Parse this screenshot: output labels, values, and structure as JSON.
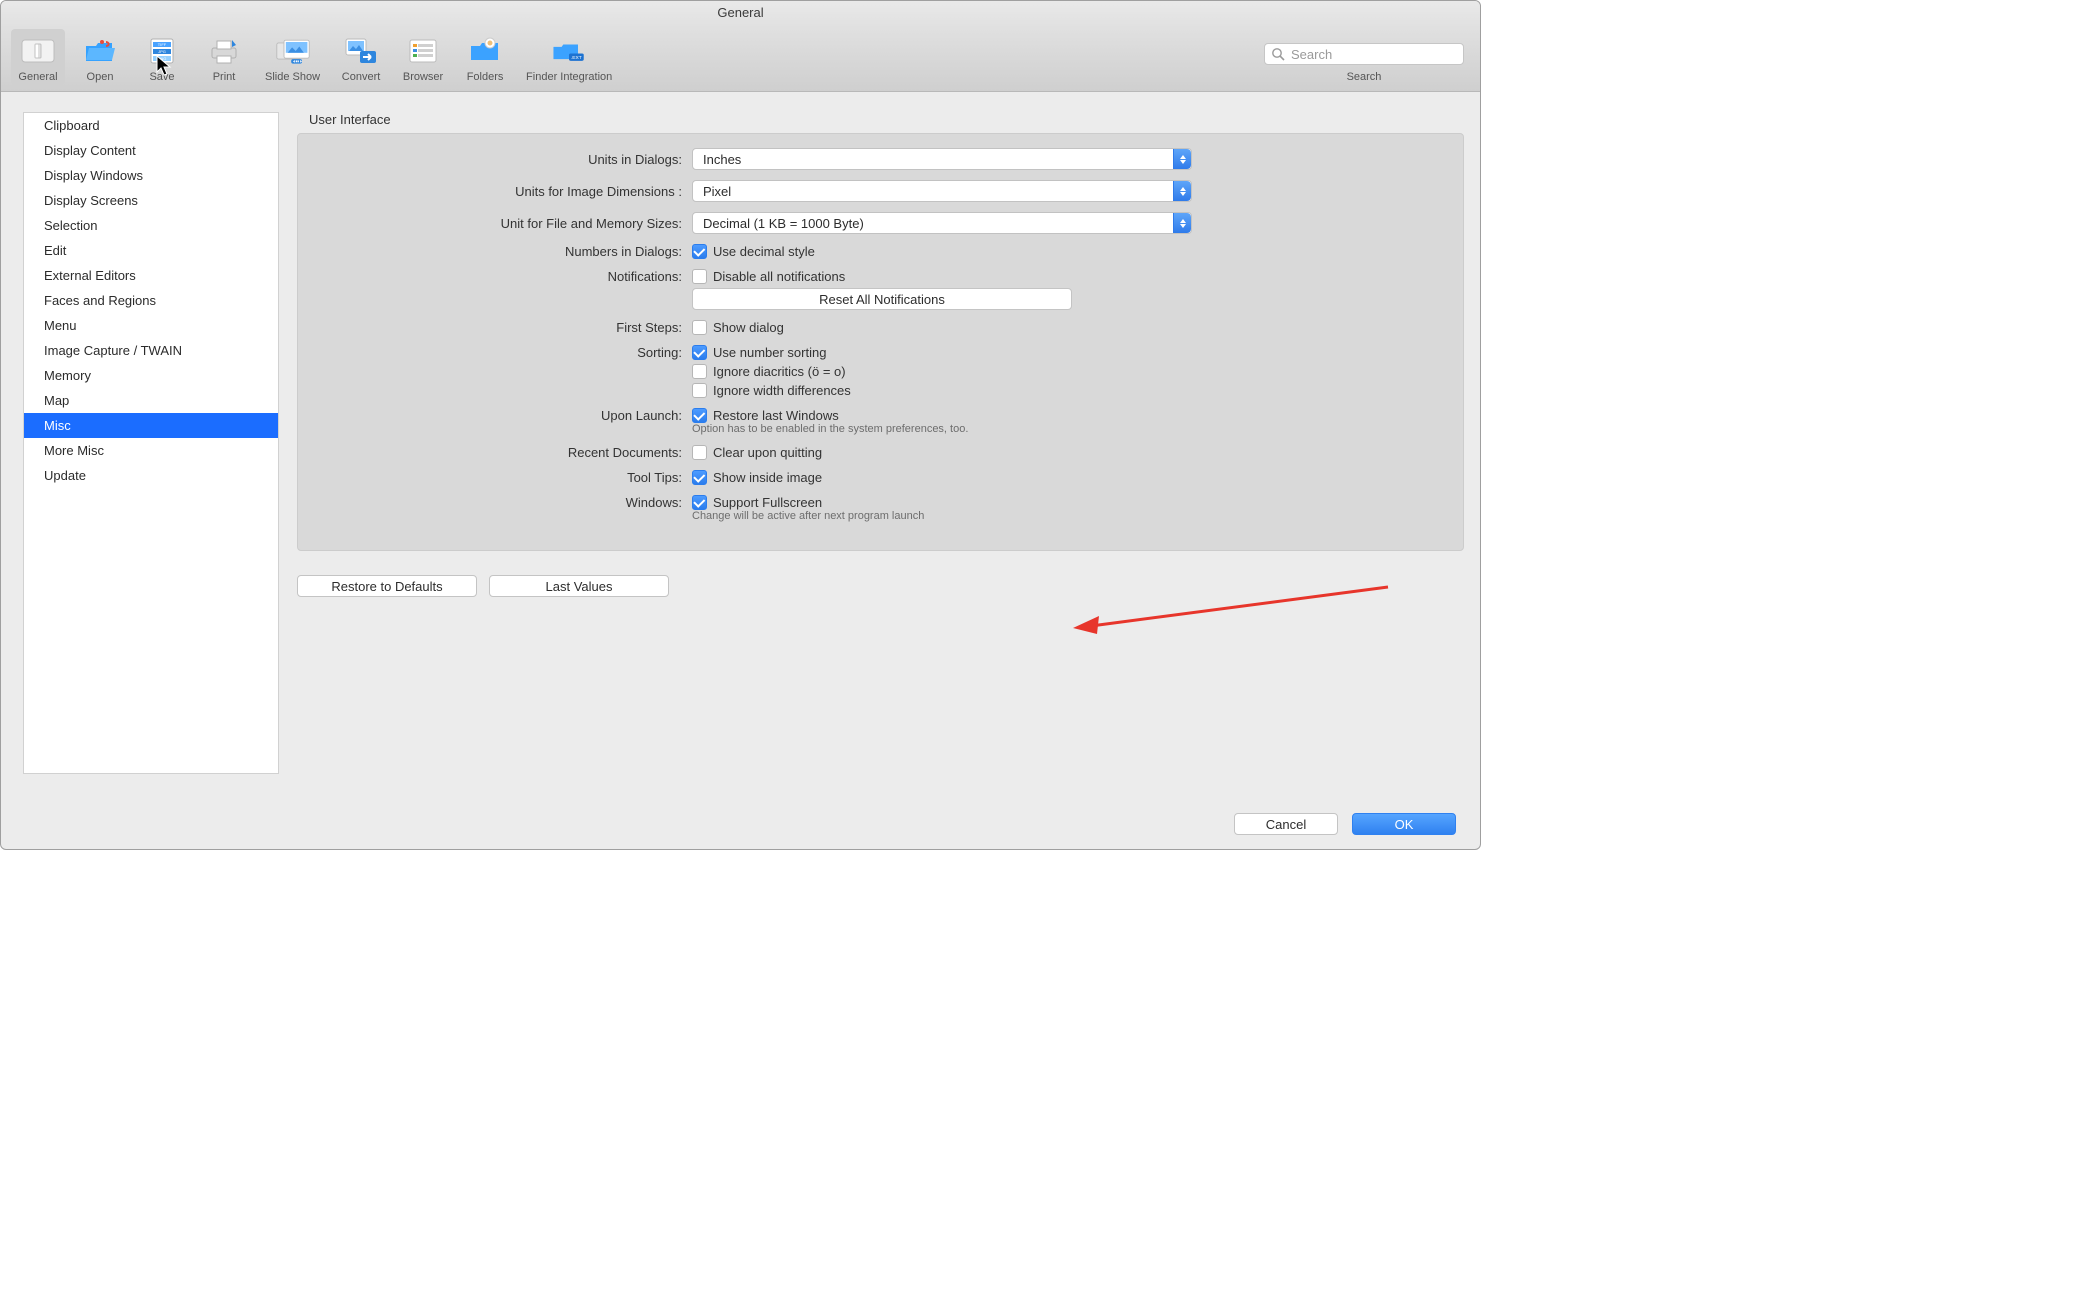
{
  "window": {
    "title": "General"
  },
  "toolbar": {
    "items": [
      {
        "label": "General"
      },
      {
        "label": "Open"
      },
      {
        "label": "Save"
      },
      {
        "label": "Print"
      },
      {
        "label": "Slide Show"
      },
      {
        "label": "Convert"
      },
      {
        "label": "Browser"
      },
      {
        "label": "Folders"
      },
      {
        "label": "Finder Integration"
      }
    ],
    "search_placeholder": "Search",
    "search_label": "Search"
  },
  "sidebar": {
    "items": [
      "Clipboard",
      "Display Content",
      "Display Windows",
      "Display Screens",
      "Selection",
      "Edit",
      "External Editors",
      "Faces and Regions",
      "Menu",
      "Image Capture / TWAIN",
      "Memory",
      "Map",
      "Misc",
      "More Misc",
      "Update"
    ],
    "selected_index": 12
  },
  "group": {
    "title": "User Interface",
    "units_dialogs": {
      "label": "Units in Dialogs:",
      "value": "Inches"
    },
    "units_image": {
      "label": "Units for Image Dimensions :",
      "value": "Pixel"
    },
    "unit_filesize": {
      "label": "Unit for File and Memory Sizes:",
      "value": "Decimal (1 KB = 1000 Byte)"
    },
    "numbers": {
      "label": "Numbers in Dialogs:",
      "text": "Use decimal style",
      "checked": true
    },
    "notifications": {
      "label": "Notifications:",
      "text": "Disable all notifications",
      "checked": false,
      "reset_button": "Reset All Notifications"
    },
    "first_steps": {
      "label": "First Steps:",
      "text": "Show dialog",
      "checked": false
    },
    "sorting": {
      "label": "Sorting:",
      "opt1_text": "Use number sorting",
      "opt1_checked": true,
      "opt2_text": "Ignore diacritics (ö = o)",
      "opt2_checked": false,
      "opt3_text": "Ignore width differences",
      "opt3_checked": false
    },
    "upon_launch": {
      "label": "Upon Launch:",
      "text": "Restore last Windows",
      "checked": true,
      "note": "Option has to be enabled in the system preferences, too."
    },
    "recent_docs": {
      "label": "Recent Documents:",
      "text": "Clear upon quitting",
      "checked": false
    },
    "tooltips": {
      "label": "Tool Tips:",
      "text": "Show inside image",
      "checked": true
    },
    "windows": {
      "label": "Windows:",
      "text": "Support Fullscreen",
      "checked": true,
      "note": "Change will be active after next program launch"
    }
  },
  "footer": {
    "restore": "Restore to Defaults",
    "last_values": "Last Values",
    "cancel": "Cancel",
    "ok": "OK"
  }
}
